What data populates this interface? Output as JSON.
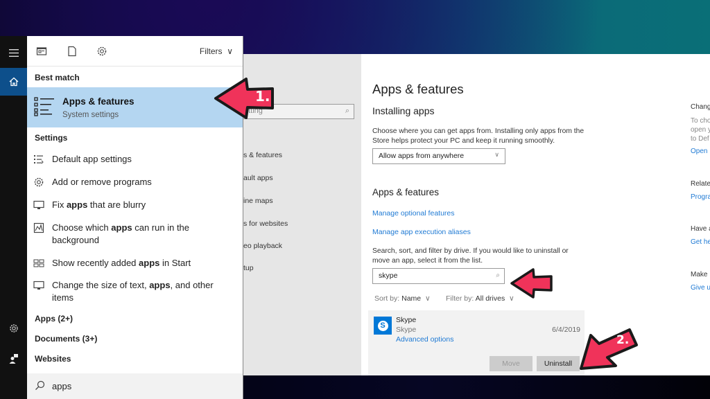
{
  "start_menu": {
    "rail": {
      "menu_icon": "hamburger-icon",
      "home_icon": "home-icon",
      "settings_icon": "gear-icon",
      "feedback_icon": "feedback-icon"
    },
    "toolbar": {
      "icons": [
        "apps-filter-icon",
        "documents-filter-icon",
        "settings-filter-icon"
      ],
      "filters_label": "Filters"
    },
    "best_match": {
      "heading": "Best match",
      "title": "Apps & features",
      "subtitle": "System settings"
    },
    "settings_group": {
      "heading": "Settings",
      "items": [
        {
          "icon": "default-apps-icon",
          "pre": "Default app settings",
          "bold": "",
          "post": ""
        },
        {
          "icon": "gear-icon",
          "pre": "Add or remove programs",
          "bold": "",
          "post": ""
        },
        {
          "icon": "monitor-icon",
          "pre": "Fix ",
          "bold": "apps",
          "post": " that are blurry"
        },
        {
          "icon": "background-apps-icon",
          "pre": "Choose which ",
          "bold": "apps",
          "post": " can run in the background"
        },
        {
          "icon": "start-tiles-icon",
          "pre": "Show recently added ",
          "bold": "apps",
          "post": " in Start"
        },
        {
          "icon": "monitor-icon",
          "pre": "Change the size of text, ",
          "bold": "apps",
          "post": ", and other items"
        }
      ]
    },
    "other_groups": [
      "Apps (2+)",
      "Documents (3+)",
      "Websites"
    ],
    "search_query": "apps"
  },
  "settings_window": {
    "nav": {
      "search_placeholder": "etting",
      "items": [
        "s & features",
        "ault apps",
        "ine maps",
        "s for websites",
        "eo playback",
        "tup"
      ]
    },
    "main": {
      "page_title": "Apps & features",
      "installing": {
        "heading": "Installing apps",
        "description": "Choose where you can get apps from. Installing only apps from the Store helps protect your PC and keep it running smoothly.",
        "dropdown_value": "Allow apps from anywhere"
      },
      "apps_features": {
        "heading": "Apps & features",
        "links": [
          "Manage optional features",
          "Manage app execution aliases"
        ],
        "description": "Search, sort, and filter by drive. If you would like to uninstall or move an app, select it from the list.",
        "search_value": "skype",
        "sort_label": "Sort by:",
        "sort_value": "Name",
        "filter_label": "Filter by:",
        "filter_value": "All drives"
      },
      "app_list": [
        {
          "name": "Skype",
          "publisher": "Skype",
          "date": "6/4/2019",
          "advanced": "Advanced options",
          "move_label": "Move",
          "uninstall_label": "Uninstall"
        }
      ]
    },
    "side": {
      "sections": [
        {
          "heading": "Chang",
          "text": [
            "To cho",
            "open y",
            "to Def"
          ],
          "link": "Open"
        },
        {
          "heading": "Relate",
          "text": [],
          "link": "Progra"
        },
        {
          "heading": "Have a",
          "text": [],
          "link": "Get he"
        },
        {
          "heading": "Make",
          "text": [],
          "link": "Give u"
        }
      ]
    }
  },
  "annotations": {
    "arrow_color": "#f0335a",
    "labels": [
      "1.",
      "2."
    ]
  }
}
